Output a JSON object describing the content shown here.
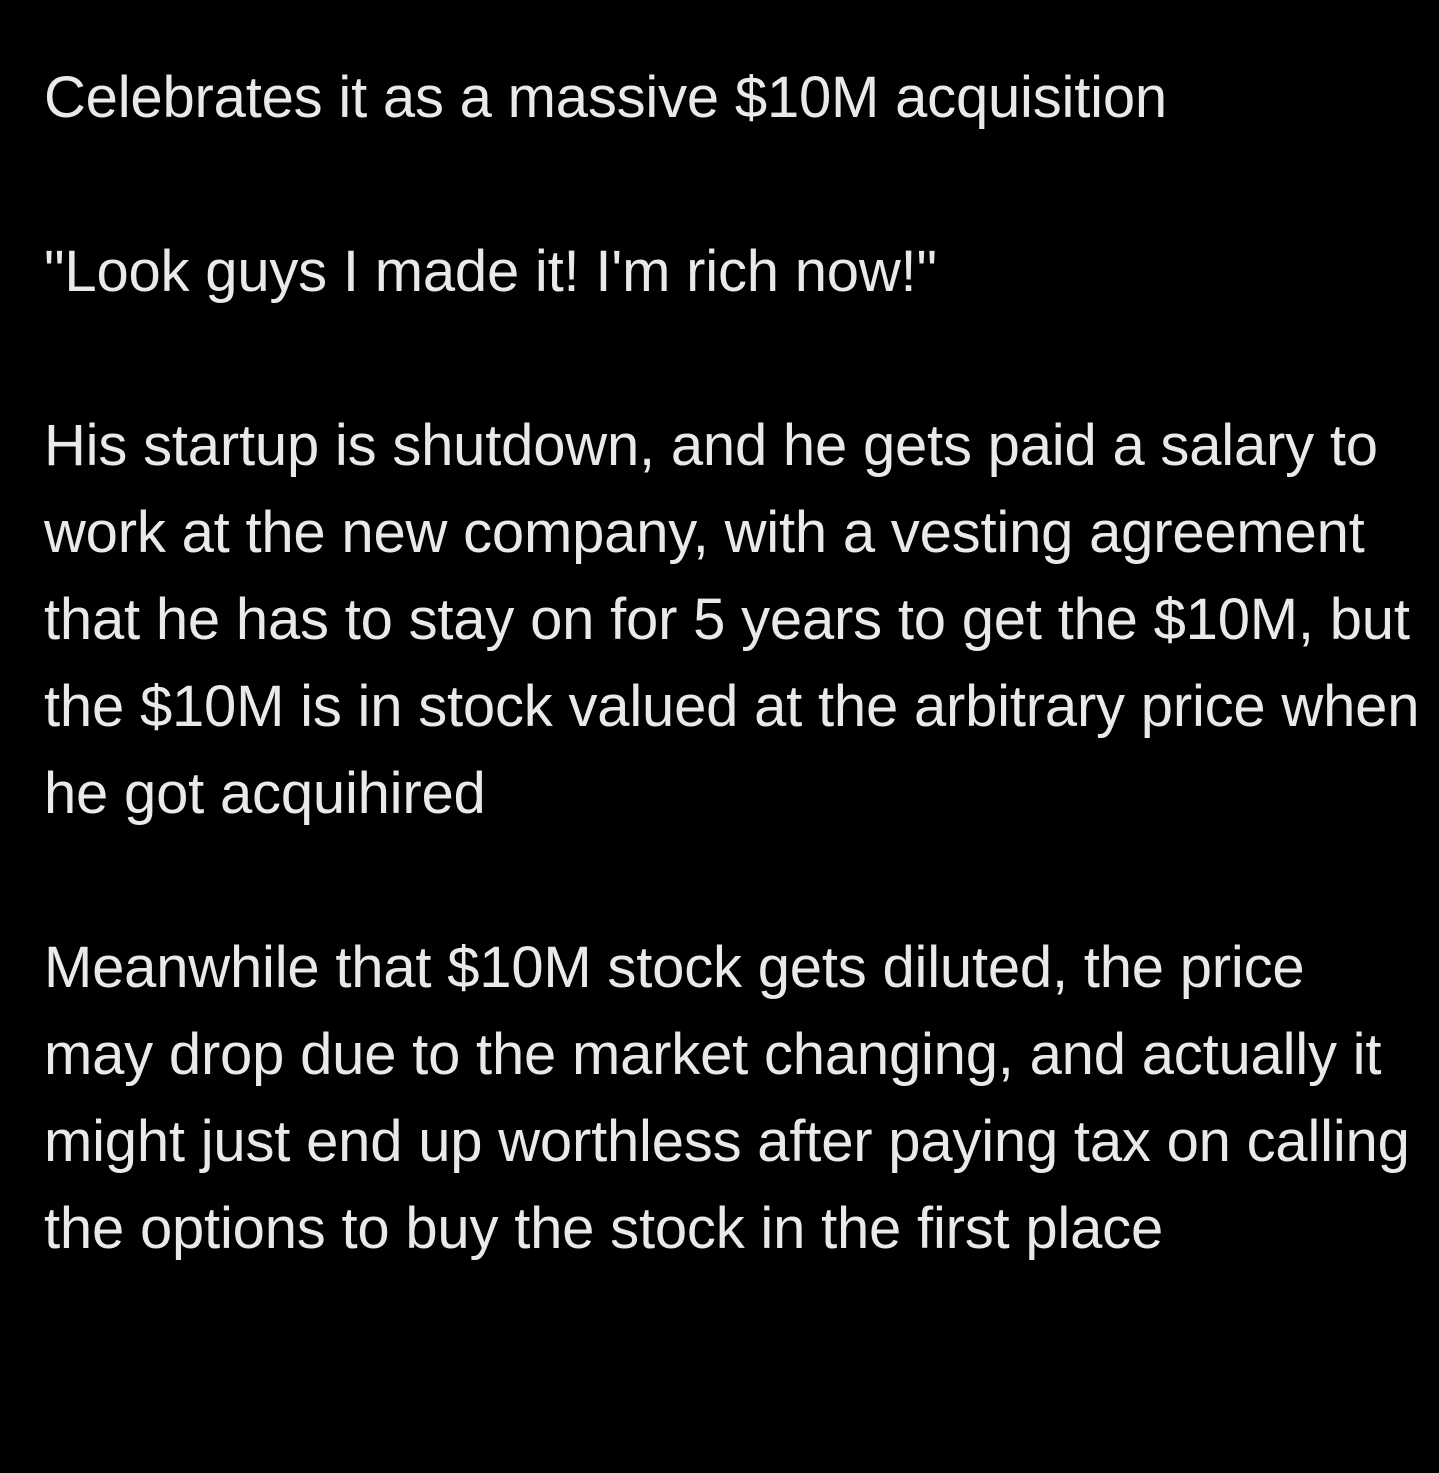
{
  "colors": {
    "background": "#000000",
    "text": "#e7e9ea"
  },
  "post": {
    "paragraphs": [
      "Celebrates it as a massive $10M acquisition",
      "\"Look guys I made it! I'm rich now!\"",
      "His startup is shutdown, and he gets paid a salary to work at the new company, with a vesting agreement that he has to stay on for 5 years to get the $10M, but the $10M is in stock valued at the arbitrary price when he got acquihired",
      "Meanwhile that $10M stock gets diluted, the price may drop due to the market changing, and actually it might just end up worthless after paying tax on calling the options to buy the stock in the first place"
    ]
  }
}
